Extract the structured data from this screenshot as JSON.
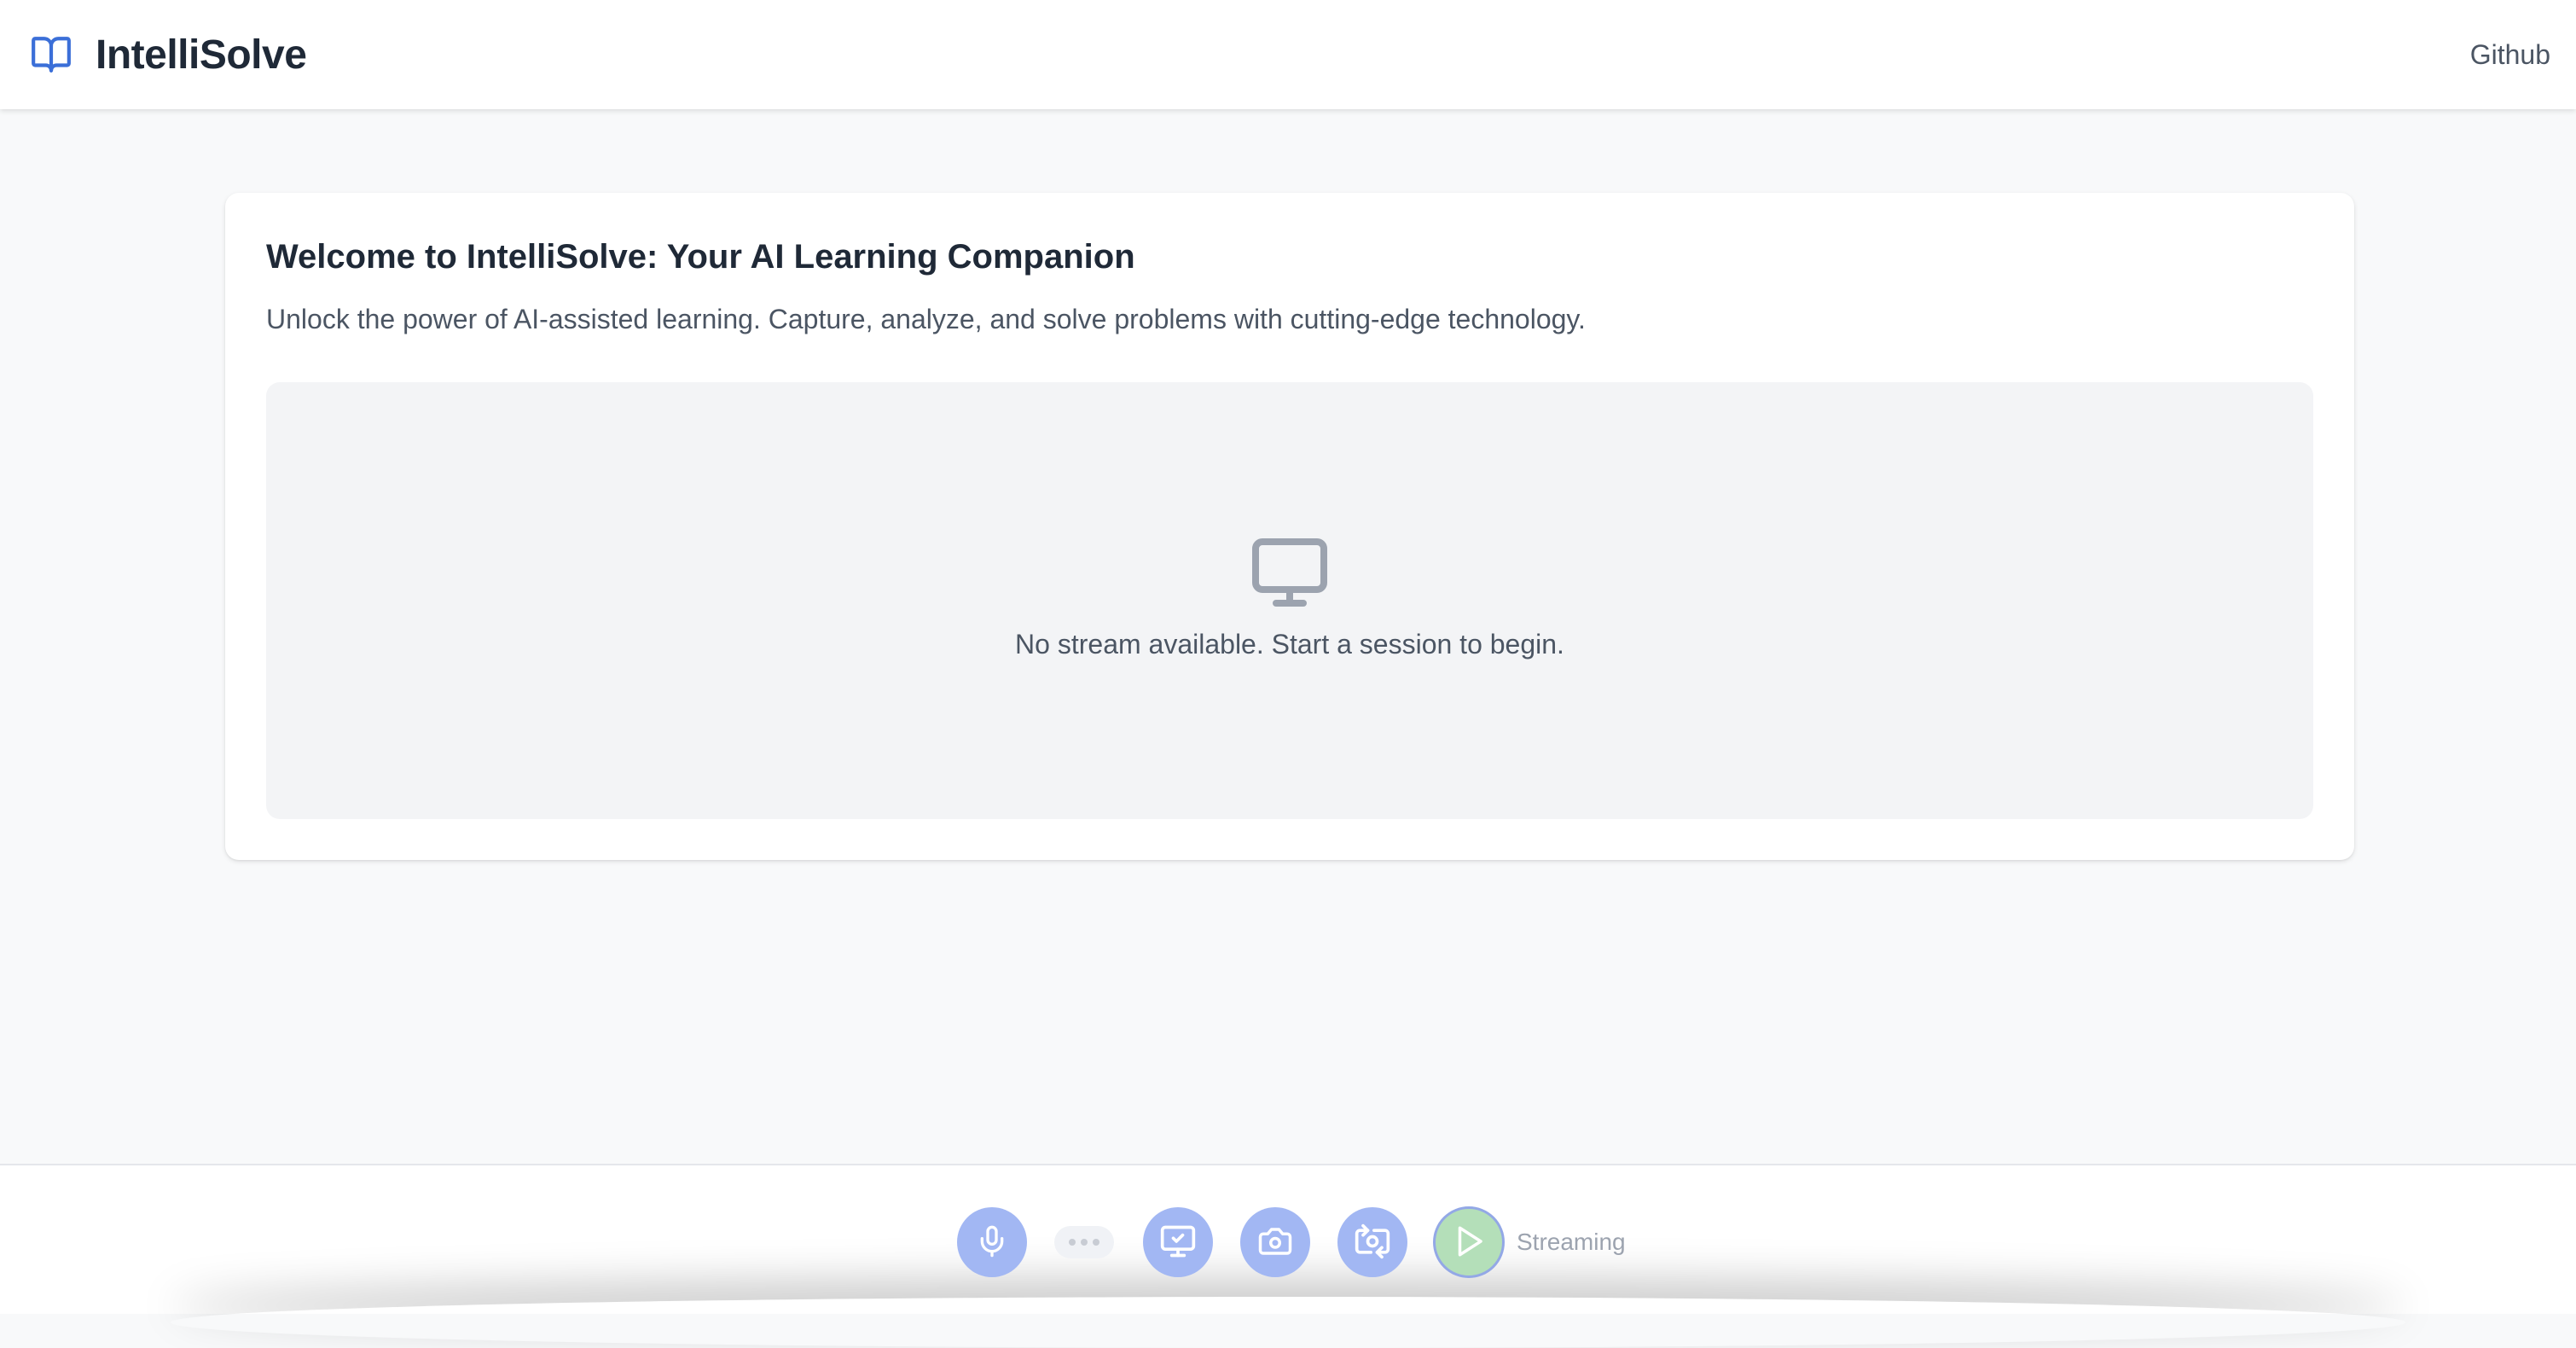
{
  "header": {
    "app_title": "IntelliSolve",
    "github_label": "Github",
    "logo_icon": "book-open-icon"
  },
  "card": {
    "title": "Welcome to IntelliSolve: Your AI Learning Companion",
    "subtitle": "Unlock the power of AI-assisted learning. Capture, analyze, and solve problems with cutting-edge technology.",
    "stream_empty_icon": "monitor-icon",
    "stream_empty_message": "No stream available. Start a session to begin."
  },
  "controls": {
    "mic_icon": "microphone-icon",
    "screen_share_icon": "monitor-check-icon",
    "camera_icon": "camera-icon",
    "switch_camera_icon": "switch-camera-icon",
    "play_icon": "play-icon",
    "streaming_label": "Streaming"
  },
  "colors": {
    "accent": "#3b6fd8",
    "control_button": "#a2b7f3",
    "play_button": "#b4dfb9",
    "page_background": "#f8f9fa"
  }
}
